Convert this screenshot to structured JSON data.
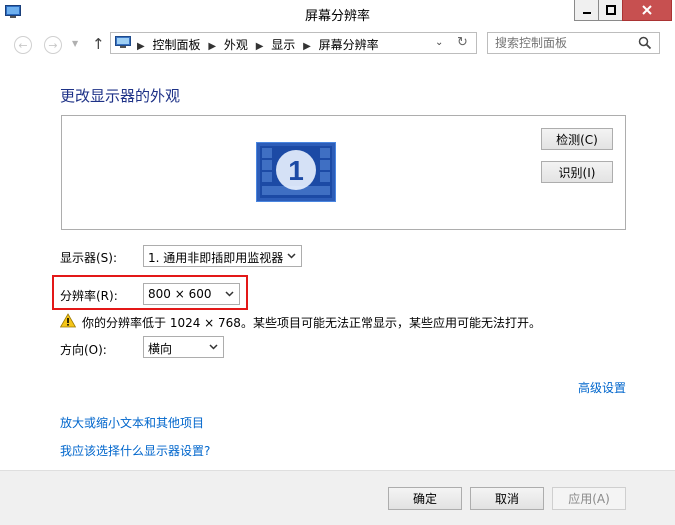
{
  "window": {
    "title": "屏幕分辨率"
  },
  "address": {
    "crumbs": [
      "控制面板",
      "外观",
      "显示",
      "屏幕分辨率"
    ]
  },
  "search": {
    "placeholder": "搜索控制面板"
  },
  "main": {
    "title": "更改显示器的外观",
    "monitor_number": "1",
    "detect_label": "检测(C)",
    "identify_label": "识别(I)",
    "display_label": "显示器(S):",
    "display_value": "1. 通用非即插即用监视器",
    "resolution_label": "分辨率(R):",
    "resolution_value": "800 × 600",
    "warning_text": "你的分辨率低于 1024 × 768。某些项目可能无法正常显示，某些应用可能无法打开。",
    "orientation_label": "方向(O):",
    "orientation_value": "横向",
    "advanced_link": "高级设置",
    "text_size_link": "放大或缩小文本和其他项目",
    "which_setting_link": "我应该选择什么显示器设置?"
  },
  "footer": {
    "ok_label": "确定",
    "cancel_label": "取消",
    "apply_label": "应用(A)"
  },
  "colors": {
    "title_blue": "#1e3287",
    "link_blue": "#0066cc",
    "highlight_red": "#e31818",
    "close_red": "#c75050"
  }
}
